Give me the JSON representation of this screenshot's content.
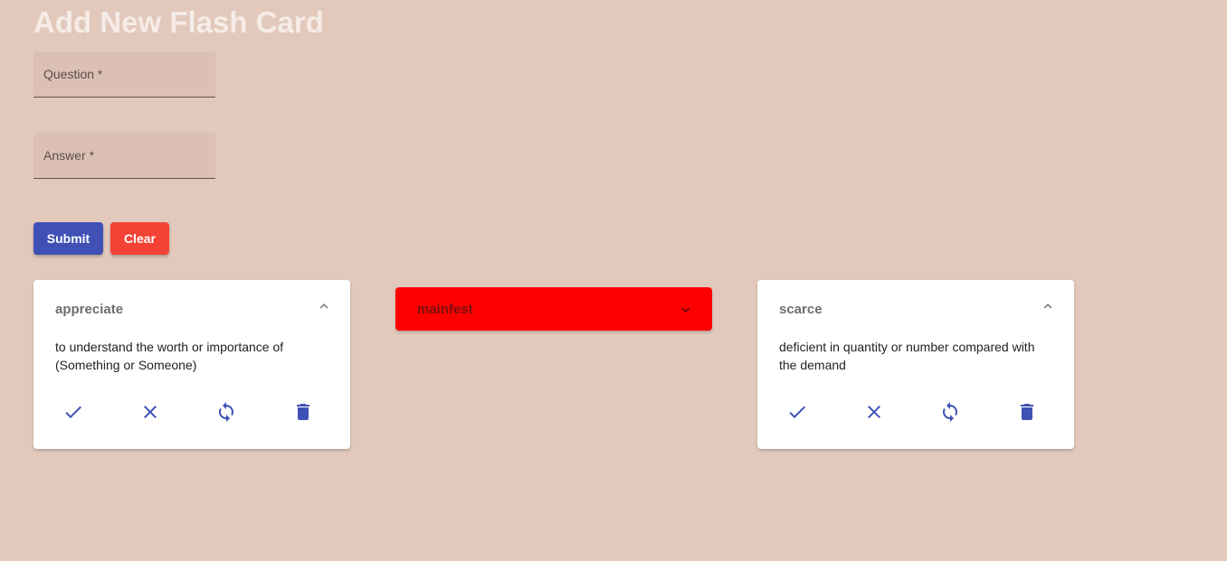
{
  "page": {
    "title": "Add New Flash Card"
  },
  "form": {
    "question_label": "Question *",
    "answer_label": "Answer *",
    "submit_label": "Submit",
    "clear_label": "Clear"
  },
  "cards": [
    {
      "question": "appreciate",
      "answer": "to understand the worth or importance of (Something or Someone)",
      "expanded": true,
      "color": "#ffffff"
    },
    {
      "question": "mainfest",
      "answer": "",
      "expanded": false,
      "color": "#ff0000"
    },
    {
      "question": "scarce",
      "answer": "deficient in quantity or number compared with the demand",
      "expanded": true,
      "color": "#ffffff"
    }
  ],
  "card_actions": [
    "check-icon",
    "close-icon",
    "sync-icon",
    "delete-icon"
  ],
  "colors": {
    "background": "#e2c9bc",
    "primary": "#3f51b5",
    "danger": "#f44336",
    "wrong_card": "#ff0000"
  }
}
